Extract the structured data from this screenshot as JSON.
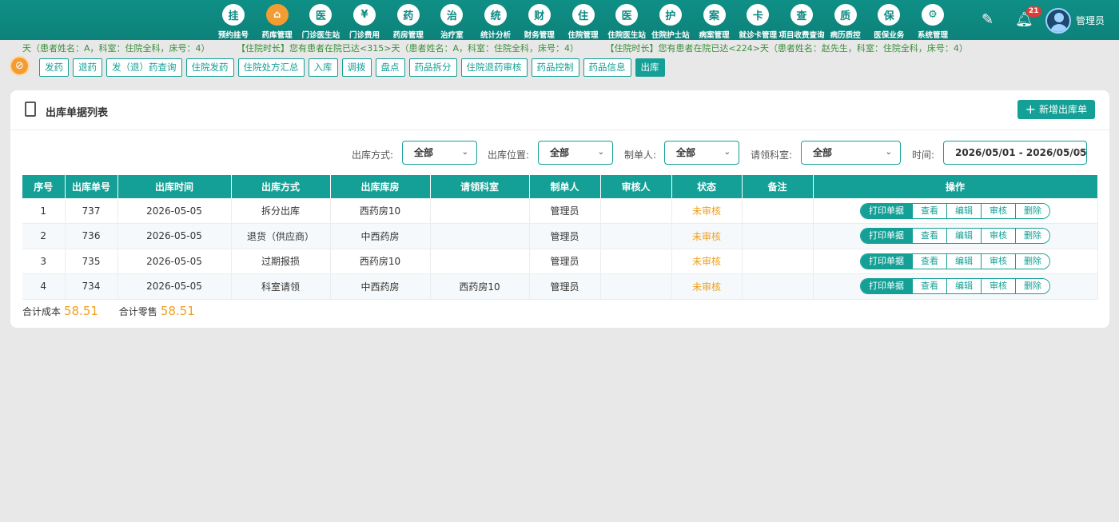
{
  "nav": {
    "items": [
      {
        "label": "预约挂号",
        "glyph": "挂"
      },
      {
        "label": "药库管理",
        "glyph": "⌂"
      },
      {
        "label": "门诊医生站",
        "glyph": "医"
      },
      {
        "label": "门诊费用",
        "glyph": "¥"
      },
      {
        "label": "药房管理",
        "glyph": "药"
      },
      {
        "label": "治疗室",
        "glyph": "治"
      },
      {
        "label": "统计分析",
        "glyph": "统"
      },
      {
        "label": "财务管理",
        "glyph": "财"
      },
      {
        "label": "住院管理",
        "glyph": "住"
      },
      {
        "label": "住院医生站",
        "glyph": "医"
      },
      {
        "label": "住院护士站",
        "glyph": "护"
      },
      {
        "label": "病案管理",
        "glyph": "案"
      },
      {
        "label": "就诊卡管理",
        "glyph": "卡"
      },
      {
        "label": "项目收费查询",
        "glyph": "查"
      },
      {
        "label": "病历质控",
        "glyph": "质"
      },
      {
        "label": "医保业务",
        "glyph": "保"
      },
      {
        "label": "系统管理",
        "glyph": "⚙"
      }
    ],
    "active_index": 1,
    "notification_count": "21",
    "username": "管理员"
  },
  "marquee": [
    "天（患者姓名：A，科室：住院全科，床号：4）",
    "【住院时长】您有患者在院已达<315>天（患者姓名：A，科室：住院全科，床号：4）",
    "【住院时长】您有患者在院已达<224>天（患者姓名：赵先生，科室：住院全科，床号：4）"
  ],
  "subtabs": [
    "发药",
    "退药",
    "发（退）药查询",
    "住院发药",
    "住院处方汇总",
    "入库",
    "调拨",
    "盘点",
    "药品拆分",
    "住院退药审核",
    "药品控制",
    "药品信息",
    "出库"
  ],
  "active_subtab": 12,
  "card": {
    "title": "出库单据列表",
    "add_button": "新增出库单"
  },
  "filters": {
    "method_label": "出库方式:",
    "method_value": "全部",
    "location_label": "出库位置:",
    "location_value": "全部",
    "creator_label": "制单人:",
    "creator_value": "全部",
    "dept_label": "请领科室:",
    "dept_value": "全部",
    "time_label": "时间:",
    "time_value": "2026/05/01 - 2026/05/05"
  },
  "table": {
    "headers": [
      "序号",
      "出库单号",
      "出库时间",
      "出库方式",
      "出库库房",
      "请领科室",
      "制单人",
      "审核人",
      "状态",
      "备注",
      "操作"
    ],
    "rows": [
      {
        "no": "1",
        "id": "737",
        "time": "2026-05-05",
        "method": "拆分出库",
        "store": "西药房10",
        "dept": "",
        "creator": "管理员",
        "auditor": "",
        "status": "未审核",
        "remark": ""
      },
      {
        "no": "2",
        "id": "736",
        "time": "2026-05-05",
        "method": "退货（供应商）",
        "store": "中西药房",
        "dept": "",
        "creator": "管理员",
        "auditor": "",
        "status": "未审核",
        "remark": ""
      },
      {
        "no": "3",
        "id": "735",
        "time": "2026-05-05",
        "method": "过期报损",
        "store": "西药房10",
        "dept": "",
        "creator": "管理员",
        "auditor": "",
        "status": "未审核",
        "remark": ""
      },
      {
        "no": "4",
        "id": "734",
        "time": "2026-05-05",
        "method": "科室请领",
        "store": "中西药房",
        "dept": "西药房10",
        "creator": "管理员",
        "auditor": "",
        "status": "未审核",
        "remark": ""
      }
    ],
    "ops": [
      "打印单据",
      "查看",
      "编辑",
      "审核",
      "删除"
    ]
  },
  "totals": {
    "cost_label": "合计成本",
    "cost_value": "58.51",
    "retail_label": "合计零售",
    "retail_value": "58.51"
  }
}
